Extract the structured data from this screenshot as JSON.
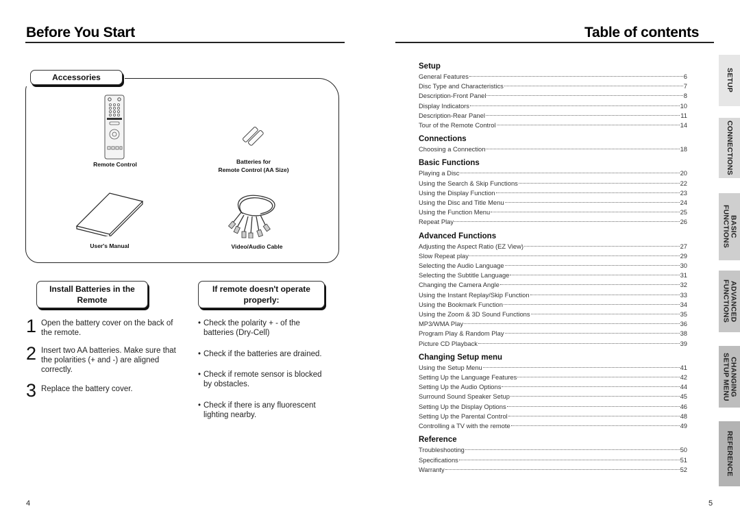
{
  "left_page": {
    "title": "Before You Start",
    "accessories": {
      "heading": "Accessories",
      "items": [
        {
          "label": "Remote Control",
          "icon": "remote-control-icon"
        },
        {
          "label": "Batteries for Remote Control (AA Size)",
          "label_line1": "Batteries for",
          "label_line2": "Remote Control (AA Size)",
          "icon": "batteries-icon"
        },
        {
          "label": "User's Manual",
          "icon": "manual-icon"
        },
        {
          "label": "Video/Audio Cable",
          "icon": "cable-icon"
        }
      ]
    },
    "install": {
      "heading_line1": "Install Batteries in the",
      "heading_line2": "Remote",
      "steps": [
        {
          "num": "1",
          "line1": "Open the battery cover on the back of",
          "line2": "the remote."
        },
        {
          "num": "2",
          "line1": "Insert two AA batteries. Make sure that",
          "line2": "the polarities (+ and -) are aligned",
          "line3": "correctly."
        },
        {
          "num": "3",
          "line1": "Replace the battery cover."
        }
      ]
    },
    "troubleshoot": {
      "heading_line1": "If remote doesn't operate",
      "heading_line2": "properly:",
      "bullets": [
        {
          "line1": "Check the polarity + - of the",
          "line2": "batteries (Dry-Cell)"
        },
        {
          "line1": "Check if the batteries are drained."
        },
        {
          "line1": "Check if remote sensor is blocked",
          "line2": "by obstacles."
        },
        {
          "line1": "Check if there is any fluorescent",
          "line2": "lighting nearby."
        }
      ]
    },
    "page_number": "4"
  },
  "right_page": {
    "title": "Table of contents",
    "sections": [
      {
        "title": "Setup",
        "entries": [
          {
            "text": "General Features",
            "page": "6"
          },
          {
            "text": "Disc Type and Characteristics",
            "page": "7"
          },
          {
            "text": "Description-Front Panel",
            "page": "8"
          },
          {
            "text": "Display Indicators",
            "page": "10"
          },
          {
            "text": "Description-Rear Panel",
            "page": "11"
          },
          {
            "text": "Tour of the Remote Control",
            "page": "14"
          }
        ]
      },
      {
        "title": "Connections",
        "entries": [
          {
            "text": "Choosing a Connection",
            "page": "18"
          }
        ]
      },
      {
        "title": "Basic Functions",
        "entries": [
          {
            "text": "Playing a Disc",
            "page": "20"
          },
          {
            "text": "Using the Search & Skip Functions",
            "page": "22"
          },
          {
            "text": "Using the Display Function",
            "page": "23"
          },
          {
            "text": "Using the Disc and Title Menu",
            "page": "24"
          },
          {
            "text": "Using the Function Menu",
            "page": "25"
          },
          {
            "text": "Repeat Play",
            "page": "26"
          }
        ]
      },
      {
        "title": "Advanced Functions",
        "entries": [
          {
            "text": "Adjusting the Aspect Ratio (EZ View)",
            "page": "27"
          },
          {
            "text": "Slow Repeat play",
            "page": "29"
          },
          {
            "text": "Selecting the Audio Language",
            "page": "30"
          },
          {
            "text": "Selecting the Subtitle Language",
            "page": "31"
          },
          {
            "text": "Changing the Camera Angle",
            "page": "32"
          },
          {
            "text": "Using the Instant Replay/Skip Function",
            "page": "33"
          },
          {
            "text": "Using the Bookmark Function",
            "page": "34"
          },
          {
            "text": "Using the Zoom & 3D Sound Functions",
            "page": "35"
          },
          {
            "text": "MP3/WMA Play",
            "page": "36"
          },
          {
            "text": "Program Play & Random Play",
            "page": "38"
          },
          {
            "text": "Picture CD Playback",
            "page": "39"
          }
        ]
      },
      {
        "title": "Changing Setup menu",
        "entries": [
          {
            "text": "Using the Setup Menu",
            "page": "41"
          },
          {
            "text": "Setting Up the Language Features",
            "page": "42"
          },
          {
            "text": "Setting Up the Audio Options",
            "page": "44"
          },
          {
            "text": "Surround Sound Speaker Setup",
            "page": "45"
          },
          {
            "text": "Setting Up the Display Options",
            "page": "46"
          },
          {
            "text": "Setting Up the Parental Control",
            "page": "48"
          },
          {
            "text": "Controlling a TV with the remote",
            "page": "49"
          }
        ]
      },
      {
        "title": "Reference",
        "entries": [
          {
            "text": "Troubleshooting",
            "page": "50"
          },
          {
            "text": "Specifications",
            "page": "51"
          },
          {
            "text": "Warranty",
            "page": "52"
          }
        ]
      }
    ],
    "side_tabs": [
      {
        "label": "SETUP",
        "shade": "#e6e6e6"
      },
      {
        "label": "CONNECTIONS",
        "shade": "#d9d9d9"
      },
      {
        "label": "BASIC FUNCTIONS",
        "shade": "#cfcfcf"
      },
      {
        "label": "ADVANCED FUNCTIONS",
        "shade": "#c6c6c6"
      },
      {
        "label": "CHANGING SETUP MENU",
        "shade": "#bdbdbd"
      },
      {
        "label": "REFERENCE",
        "shade": "#b3b3b3"
      }
    ],
    "page_number": "5"
  }
}
